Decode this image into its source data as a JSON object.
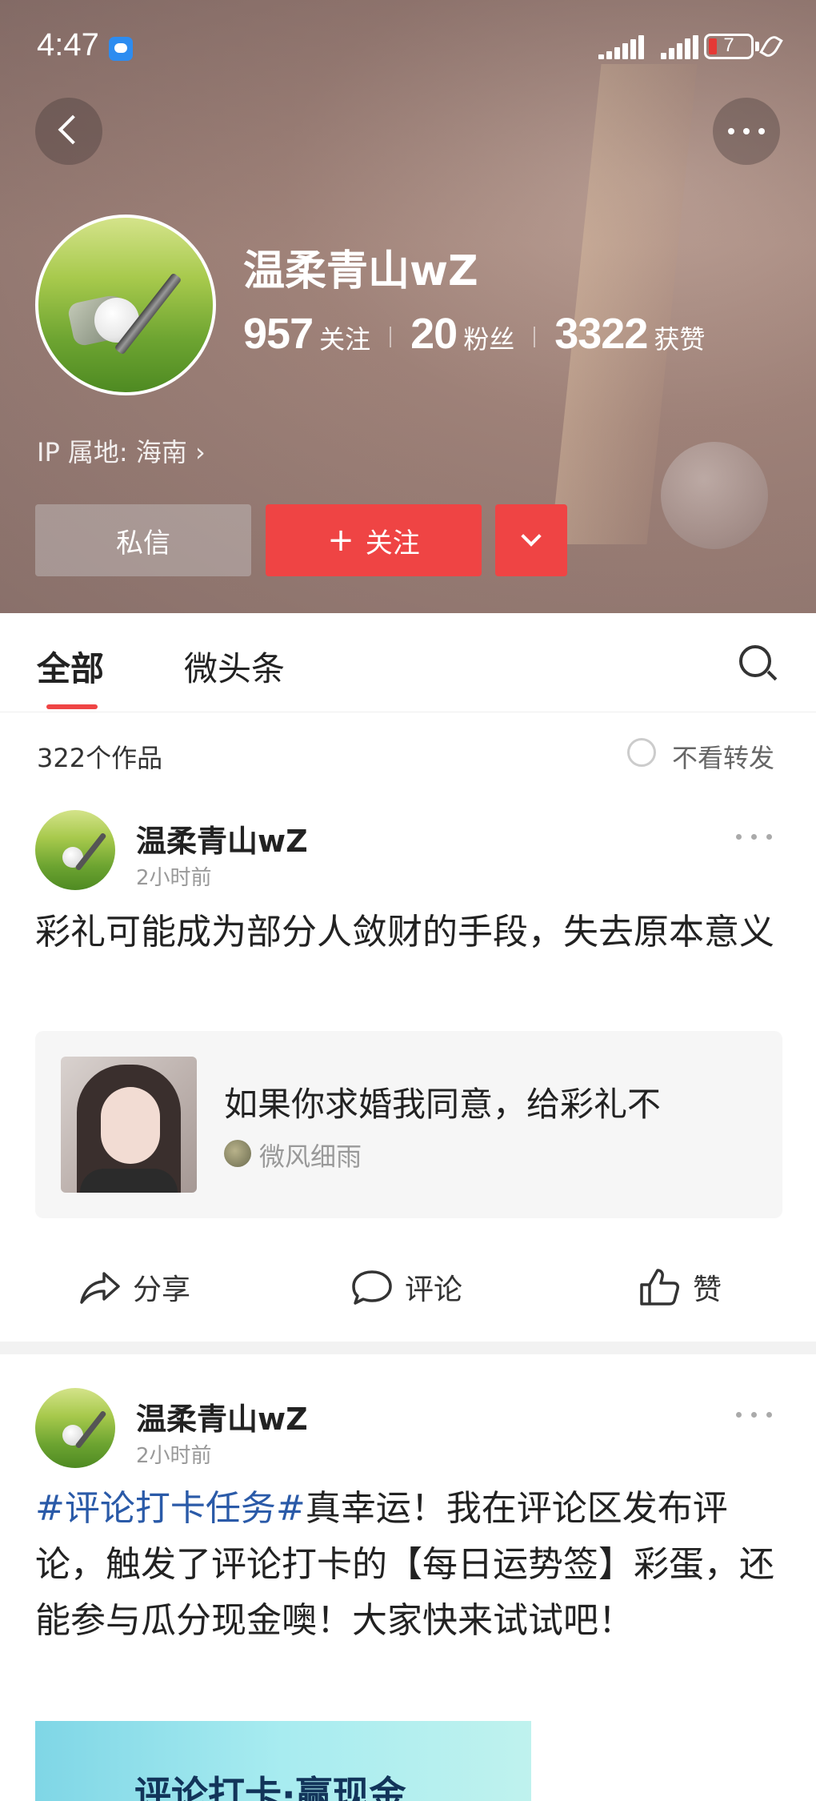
{
  "status_bar": {
    "time": "4:47",
    "battery": "7"
  },
  "profile": {
    "name": "温柔青山wZ",
    "stats": [
      {
        "value": "957",
        "label": "关注"
      },
      {
        "value": "20",
        "label": "粉丝"
      },
      {
        "value": "3322",
        "label": "获赞"
      }
    ],
    "ip_location": "IP 属地: 海南 ›",
    "message_button": "私信",
    "follow_button": "关注",
    "follow_plus": "+"
  },
  "tabs": {
    "items": [
      "全部",
      "微头条"
    ],
    "active": "全部"
  },
  "works": {
    "count": "322个作品",
    "filter_label": "不看转发"
  },
  "posts": [
    {
      "author": "温柔青山wZ",
      "time": "2小时前",
      "text": "彩礼可能成为部分人敛财的手段，失去原本意义",
      "quote": {
        "title": "如果你求婚我同意，给彩礼不",
        "author": "微风细雨"
      },
      "actions": {
        "share": "分享",
        "comment": "评论",
        "like": "赞"
      }
    },
    {
      "author": "温柔青山wZ",
      "time": "2小时前",
      "hashtag": "#评论打卡任务#",
      "text": "真幸运！我在评论区发布评论，触发了评论打卡的【每日运势签】彩蛋，还能参与瓜分现金噢！大家快来试试吧！",
      "banner_text": "评论打卡·赢现金"
    }
  ],
  "colors": {
    "accent": "#ef4444",
    "hashtag": "#2a5aa8"
  },
  "icons": [
    "back-icon",
    "more-icon",
    "chevron-down-icon",
    "search-icon",
    "share-icon",
    "comment-icon",
    "like-icon"
  ]
}
